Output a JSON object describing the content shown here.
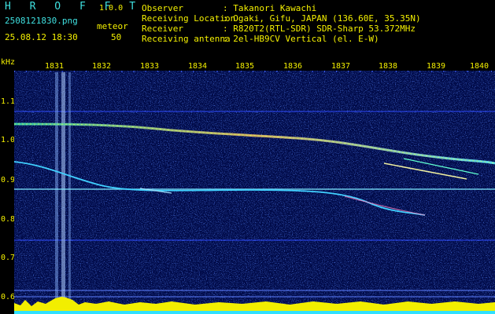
{
  "app": {
    "logo": "H R O F F T",
    "version": "1.0.0",
    "filename": "2508121830.png",
    "datetime": "25.08.12 18:30",
    "meteor_label": "meteor",
    "meteor_count": "50"
  },
  "info": {
    "observer_label": "Observer",
    "observer_value": ": Takanori Kawachi",
    "location_label": "Receiving Location",
    "location_value": ": Ogaki, Gifu, JAPAN (136.60E, 35.35N)",
    "receiver_label": "Receiver",
    "receiver_value": ": R820T2(RTL-SDR) SDR-Sharp 53.372MHz",
    "antenna_label": "Receiving antenna",
    "antenna_value": ": 2el-HB9CV Vertical (el. E-W)"
  },
  "axis": {
    "y_unit": "kHz",
    "y_ticks": [
      "1.1",
      "1.0",
      "0.9",
      "0.8",
      "0.7",
      "0.6"
    ],
    "x_ticks": [
      "1831",
      "1832",
      "1833",
      "1834",
      "1835",
      "1836",
      "1837",
      "1838",
      "1839",
      "1840"
    ]
  },
  "colors": {
    "background": "#000000",
    "spectrogram": "#000a48",
    "text_cyan": "#3fe0e0",
    "text_yellow": "#f4f000"
  }
}
